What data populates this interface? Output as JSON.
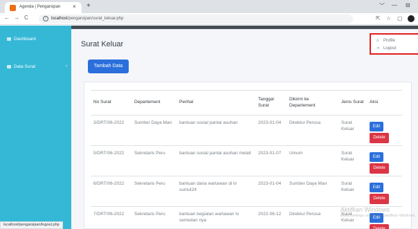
{
  "browser": {
    "tab_title": "Agenda | Pengarsipan",
    "tab_close": "×",
    "new_tab": "+",
    "url_host": "localhost",
    "url_path": "/pengarsipan/surat_keluar.php",
    "status_url": "localhost/pengarsipan/logout.php",
    "icons": [
      "back-icon",
      "forward-icon",
      "reload-icon",
      "info-icon",
      "share-icon",
      "star-icon",
      "sidepanel-icon",
      "profile-icon"
    ]
  },
  "sidebar": {
    "items": [
      {
        "label": "Dashboard",
        "icon": "dashboard-icon"
      },
      {
        "label": "Data Surat",
        "icon": "mail-icon",
        "chevron": "›"
      }
    ]
  },
  "main": {
    "title": "Surat Keluar",
    "add_button": "Tambah Data"
  },
  "table": {
    "headers": [
      "No Surat",
      "Departement",
      "Perihal",
      "Tanggal Surat",
      "Dikirim ke Departement",
      "Jenis Surat",
      "Aksi"
    ],
    "rows": [
      {
        "no": "3/DRT/06-2022",
        "dept": "Sumber Daya Man",
        "perihal": "bantuan sosial pantai asuhan",
        "tanggal": "2023-01-04",
        "tujuan": "Direktur Perusa",
        "jenis": "Surat Keluar"
      },
      {
        "no": "5/DRT/06-2022",
        "dept": "Sekretaris Peru",
        "perihal": "bantuan sosial pantai asuhan melati",
        "tanggal": "2023-01-07",
        "tujuan": "Umum",
        "jenis": "Surat Keluar"
      },
      {
        "no": "6/DRT/06-2022",
        "dept": "Sekretaris Peru",
        "perihal": "bantuan dana wartawan di tv sumut24",
        "tanggal": "2023-01-04",
        "tujuan": "Sumber Daya Man",
        "jenis": "Surat Keluar"
      },
      {
        "no": "7/DRT/06-2022",
        "dept": "Sekretaris Peru",
        "perihal": "bantuan kegiatan wartawan tv semedan nya",
        "tanggal": "2022-06-12",
        "tujuan": "Direktur Perusa",
        "jenis": "Surat Keluar"
      }
    ],
    "edit_label": "Edit",
    "delete_label": "Delete"
  },
  "dropdown": {
    "profile": "Profile",
    "logout": "Logout",
    "highlight_color": "#e21c1c"
  },
  "watermark": {
    "line1": "Aktifkan Windows",
    "line2": "Buka Settings untuk mengaktifkan Windows."
  },
  "colors": {
    "sidebar": "#35b8d6",
    "primary": "#2a6fdb",
    "danger": "#dc3545"
  }
}
